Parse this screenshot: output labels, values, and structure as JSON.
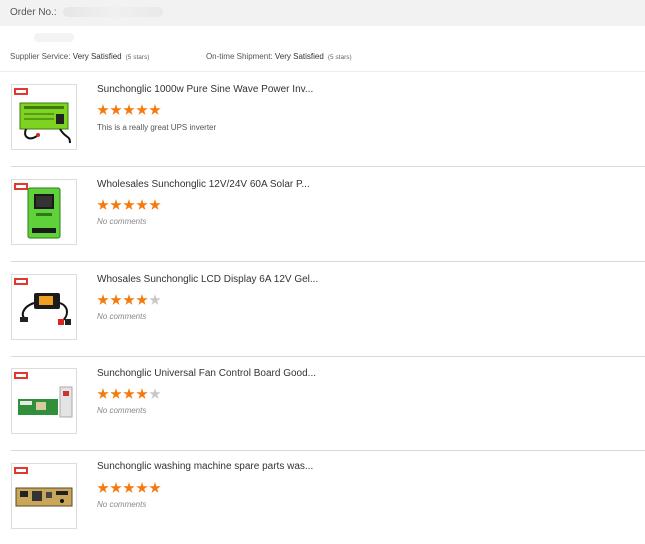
{
  "order": {
    "label": "Order No.:"
  },
  "ratings": {
    "supplier_label": "Supplier Service:",
    "supplier_value": "Very Satisfied",
    "supplier_stars": "(5 stars)",
    "shipment_label": "On-time Shipment:",
    "shipment_value": "Very Satisfied",
    "shipment_stars": "(5 stars)"
  },
  "colors": {
    "star_on": "#f47a0d",
    "star_off": "#c8c8c8"
  },
  "reviews": [
    {
      "title": "Sunchonglic 1000w Pure Sine Wave Power Inv...",
      "rating": 5,
      "comment": "This is a really great UPS inverter",
      "image": "inverter-product-image"
    },
    {
      "title": "Wholesales Sunchonglic 12V/24V 60A Solar P...",
      "rating": 5,
      "comment": "No comments",
      "image": "solar-controller-product-image"
    },
    {
      "title": "Whosales Sunchonglic LCD Display 6A 12V Gel...",
      "rating": 4,
      "comment": "No comments",
      "image": "battery-charger-product-image"
    },
    {
      "title": "Sunchonglic Universal Fan Control Board Good...",
      "rating": 4,
      "comment": "No comments",
      "image": "fan-control-board-product-image"
    },
    {
      "title": "Sunchonglic washing machine spare parts was...",
      "rating": 5,
      "comment": "No comments",
      "image": "washing-machine-board-product-image"
    }
  ]
}
